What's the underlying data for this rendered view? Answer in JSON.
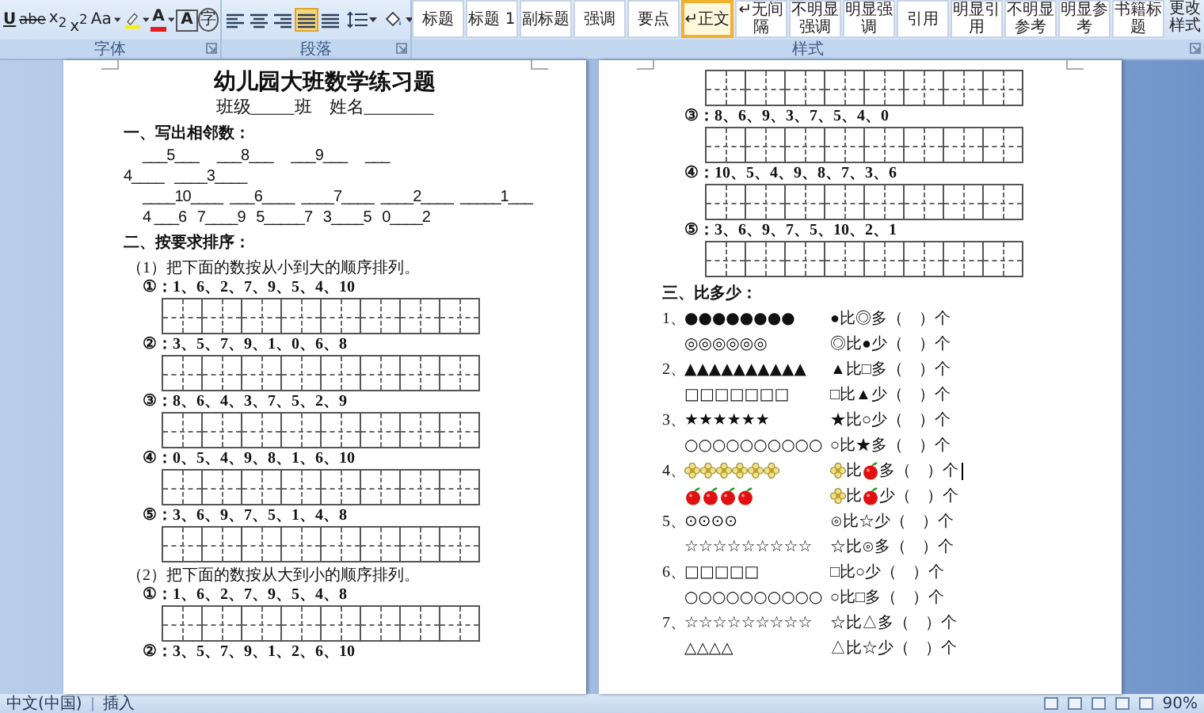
{
  "ribbon": {
    "font_tools": [
      {
        "kind": "underline",
        "label": "U"
      },
      {
        "kind": "strike",
        "label": "abe"
      },
      {
        "kind": "subscript",
        "label": "x$_{2}$"
      },
      {
        "kind": "superscript",
        "label": "x$^{2}$"
      },
      {
        "kind": "case",
        "label": "Aa"
      },
      {
        "kind": "highlight"
      },
      {
        "kind": "font_color",
        "label": "A"
      },
      {
        "kind": "border",
        "label": "A"
      },
      {
        "kind": "enclose",
        "label": "字"
      }
    ],
    "font_label": "字体",
    "align": [
      {
        "kind": "left",
        "selected": false
      },
      {
        "kind": "center",
        "selected": false
      },
      {
        "kind": "right",
        "selected": false
      },
      {
        "kind": "justify",
        "selected": true
      },
      {
        "kind": "distribute",
        "selected": false
      }
    ],
    "paragraph_label": "段落",
    "styles": [
      {
        "label": "标题",
        "selected": false
      },
      {
        "label": "标题 1",
        "selected": false
      },
      {
        "label": "副标题",
        "selected": false
      },
      {
        "label": "强调",
        "selected": false
      },
      {
        "label": "要点",
        "selected": false
      },
      {
        "label": "↵正文",
        "selected": true
      },
      {
        "label": "↵无间隔",
        "selected": false
      },
      {
        "label": "不明显强调",
        "selected": false
      },
      {
        "label": "明显强调",
        "selected": false
      },
      {
        "label": "引用",
        "selected": false
      },
      {
        "label": "明显引用",
        "selected": false
      },
      {
        "label": "不明显参考",
        "selected": false
      },
      {
        "label": "明显参考",
        "selected": false
      },
      {
        "label": "书籍标题",
        "selected": false
      }
    ],
    "change_styles": "更改样式",
    "styles_label": "样式"
  },
  "pages": [
    {
      "blocks": [
        {
          "kind": "title",
          "text": "幼儿园大班数学练习题"
        },
        {
          "kind": "subtitle",
          "text": "班级_____班　姓名________"
        },
        {
          "kind": "heading",
          "text": "一、写出相邻数："
        },
        {
          "kind": "fill",
          "text": "___5___     ___8___     ___9___     ___"
        },
        {
          "kind": "fill_flush",
          "text": "4____   ____3____"
        },
        {
          "kind": "fill",
          "text": "____10____  ___6____  ____7____  ____2____  _____1___"
        },
        {
          "kind": "fill",
          "text": "4 ___6   7____9   5_____7   3____5   0____2"
        },
        {
          "kind": "heading",
          "text": "二、按要求排序："
        },
        {
          "kind": "instruction",
          "text": "（1）把下面的数按从小到大的顺序排列。"
        },
        {
          "kind": "sequence",
          "text": "①：1、6、2、7、9、5、4、10"
        },
        {
          "kind": "grid"
        },
        {
          "kind": "sequence",
          "text": "②：3、5、7、9、1、0、6、8"
        },
        {
          "kind": "grid"
        },
        {
          "kind": "sequence",
          "text": "③：8、6、4、3、7、5、2、9"
        },
        {
          "kind": "grid"
        },
        {
          "kind": "sequence",
          "text": "④：0、5、4、9、8、1、6、10"
        },
        {
          "kind": "grid"
        },
        {
          "kind": "sequence",
          "text": "⑤：3、6、9、7、5、1、4、8"
        },
        {
          "kind": "grid"
        },
        {
          "kind": "instruction",
          "text": "（2）把下面的数按从大到小的顺序排列。"
        },
        {
          "kind": "sequence",
          "text": "①：1、6、2、7、9、5、4、8"
        },
        {
          "kind": "grid"
        },
        {
          "kind": "sequence",
          "text": "②：3、5、7、9、1、2、6、10"
        }
      ]
    },
    {
      "blocks": [
        {
          "kind": "grid"
        },
        {
          "kind": "sequence",
          "text": "③：8、6、9、3、7、5、4、0"
        },
        {
          "kind": "grid"
        },
        {
          "kind": "sequence",
          "text": "④：10、5、4、9、8、7、3、6"
        },
        {
          "kind": "grid"
        },
        {
          "kind": "sequence",
          "text": "⑤：3、6、9、7、5、10、2、1"
        },
        {
          "kind": "grid"
        },
        {
          "kind": "heading",
          "text": "三、比多少："
        },
        {
          "kind": "compare",
          "number": "1、",
          "left": [
            {
              "kind": "text",
              "text": "●●●●●●●●"
            }
          ],
          "right": [
            {
              "kind": "text",
              "text": "●比◎多（　）个"
            }
          ]
        },
        {
          "kind": "compare",
          "left": [
            {
              "kind": "text",
              "text": "◎◎◎◎◎◎"
            }
          ],
          "right": [
            {
              "kind": "text",
              "text": "◎比●少（　）个"
            }
          ]
        },
        {
          "kind": "compare",
          "number": "2、",
          "left": [
            {
              "kind": "text",
              "text": "▲▲▲▲▲▲▲▲▲▲"
            }
          ],
          "right": [
            {
              "kind": "text",
              "text": "▲比□多（　）个"
            }
          ]
        },
        {
          "kind": "compare",
          "left": [
            {
              "kind": "text",
              "text": "□□□□□□□"
            }
          ],
          "right": [
            {
              "kind": "text",
              "text": "□比▲少（　）个"
            }
          ]
        },
        {
          "kind": "compare",
          "number": "3、",
          "left": [
            {
              "kind": "text",
              "text": "★★★★★★"
            }
          ],
          "right": [
            {
              "kind": "text",
              "text": "★比○少（　）个"
            }
          ]
        },
        {
          "kind": "compare",
          "left": [
            {
              "kind": "text",
              "text": "○○○○○○○○○○"
            }
          ],
          "right": [
            {
              "kind": "text",
              "text": "○比★多（　）个"
            }
          ]
        },
        {
          "kind": "compare",
          "number": "4、",
          "left": [
            {
              "kind": "flower"
            },
            {
              "kind": "flower"
            },
            {
              "kind": "flower"
            },
            {
              "kind": "flower"
            },
            {
              "kind": "flower"
            },
            {
              "kind": "flower"
            }
          ],
          "right": [
            {
              "kind": "flower"
            },
            {
              "kind": "text",
              "text": "比"
            },
            {
              "kind": "apple"
            },
            {
              "kind": "text",
              "text": "多（　）个"
            },
            {
              "kind": "cursor"
            }
          ]
        },
        {
          "kind": "compare",
          "left": [
            {
              "kind": "apple"
            },
            {
              "kind": "apple"
            },
            {
              "kind": "apple"
            },
            {
              "kind": "apple"
            }
          ],
          "right": [
            {
              "kind": "flower"
            },
            {
              "kind": "text",
              "text": "比"
            },
            {
              "kind": "apple"
            },
            {
              "kind": "text",
              "text": "少（　）个"
            }
          ]
        },
        {
          "kind": "compare",
          "number": "5、",
          "left": [
            {
              "kind": "text",
              "text": "⊙⊙⊙⊙"
            }
          ],
          "right": [
            {
              "kind": "text",
              "text": "⊙比☆少（　）个"
            }
          ]
        },
        {
          "kind": "compare",
          "left": [
            {
              "kind": "text",
              "text": "☆☆☆☆☆☆☆☆☆"
            }
          ],
          "right": [
            {
              "kind": "text",
              "text": "☆比⊙多（　）个"
            }
          ]
        },
        {
          "kind": "compare",
          "number": "6、",
          "left": [
            {
              "kind": "text",
              "text": "□□□□□"
            }
          ],
          "right": [
            {
              "kind": "text",
              "text": "□比○少（　）个"
            }
          ]
        },
        {
          "kind": "compare",
          "left": [
            {
              "kind": "text",
              "text": "○○○○○○○○○○"
            }
          ],
          "right": [
            {
              "kind": "text",
              "text": "○比□多（　）个"
            }
          ]
        },
        {
          "kind": "compare",
          "number": "7、",
          "left": [
            {
              "kind": "text",
              "text": "☆☆☆☆☆☆☆☆☆"
            }
          ],
          "right": [
            {
              "kind": "text",
              "text": "☆比△多（　）个"
            }
          ]
        },
        {
          "kind": "compare",
          "left": [
            {
              "kind": "text",
              "text": "△△△△"
            }
          ],
          "right": [
            {
              "kind": "text",
              "text": "△比☆少（　）个"
            }
          ]
        }
      ]
    }
  ],
  "status_bar": {
    "language": "中文(中国)",
    "mode": "插入",
    "zoom": "90%"
  }
}
